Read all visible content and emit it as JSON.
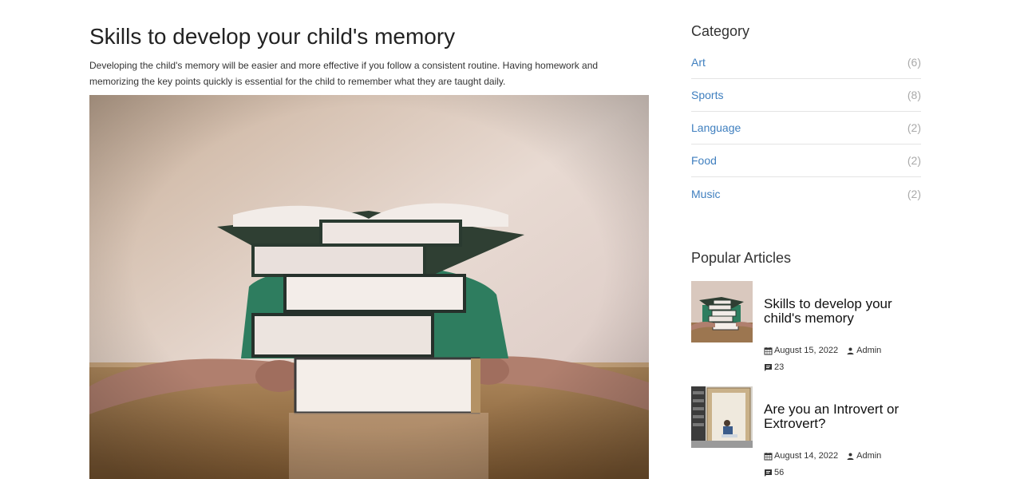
{
  "article": {
    "title": "Skills to develop your child's memory",
    "intro": "Developing the child's memory will be easier and more effective if you follow a consistent routine. Having homework and memorizing the key points quickly is essential for the child to remember what they are taught daily."
  },
  "sidebar": {
    "category_heading": "Category",
    "categories": [
      {
        "name": "Art",
        "count": "(6)"
      },
      {
        "name": "Sports",
        "count": "(8)"
      },
      {
        "name": "Language",
        "count": "(2)"
      },
      {
        "name": "Food",
        "count": "(2)"
      },
      {
        "name": "Music",
        "count": "(2)"
      }
    ],
    "popular_heading": "Popular Articles",
    "popular": [
      {
        "title": "Skills to develop your child's memory",
        "date": "August 15, 2022",
        "author": "Admin",
        "comments": "23"
      },
      {
        "title": "Are you an Introvert or Extrovert?",
        "date": "August 14, 2022",
        "author": "Admin",
        "comments": "56"
      }
    ]
  },
  "colors": {
    "link": "#3f7fbf",
    "count": "#aaaaaa",
    "divider": "#e4e4e4"
  },
  "icons": [
    "calendar-icon",
    "user-icon",
    "comment-icon"
  ]
}
